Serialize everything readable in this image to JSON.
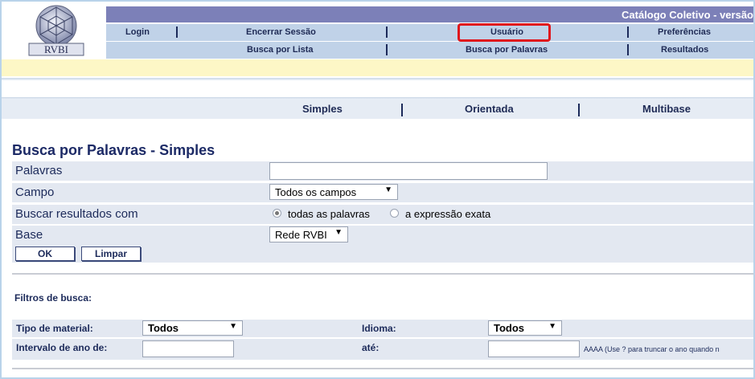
{
  "header": {
    "catalog_title": "Catálogo Coletivo - versão",
    "logo_text": "RVBI",
    "nav_row1": [
      "Login",
      "Encerrar Sessão",
      "Usuário",
      "Preferências"
    ],
    "nav_row2": [
      "Busca por Lista",
      "Busca por Palavras",
      "Resultados"
    ]
  },
  "subnav": [
    "Simples",
    "Orientada",
    "Multibase"
  ],
  "page_title": "Busca por Palavras - Simples",
  "form": {
    "palavras_label": "Palavras",
    "palavras_value": "",
    "campo_label": "Campo",
    "campo_value": "Todos os campos",
    "buscar_label": "Buscar resultados com",
    "radio_all": "todas as palavras",
    "radio_exact": "a expressão exata",
    "base_label": "Base",
    "base_value": "Rede RVBI",
    "ok_label": "OK",
    "limpar_label": "Limpar"
  },
  "filters": {
    "title": "Filtros de busca:",
    "tipo_label": "Tipo de material:",
    "tipo_value": "Todos",
    "idioma_label": "Idioma:",
    "idioma_value": "Todos",
    "intervalo_label": "Intervalo de ano de:",
    "ate_label": "até:",
    "hint": "AAAA (Use ? para truncar o ano quando n"
  },
  "colors": {
    "highlight": "#e0161c",
    "band": "#7c80b8",
    "nav_bg": "#c0d2e8"
  }
}
